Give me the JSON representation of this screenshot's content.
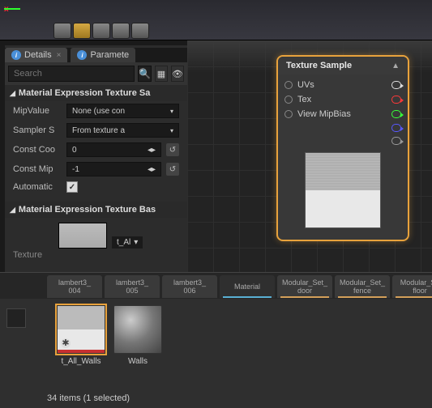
{
  "axis": {
    "x_label": "x"
  },
  "tabs": {
    "details": "Details",
    "parameters": "Paramete"
  },
  "search": {
    "placeholder": "Search"
  },
  "section1": {
    "title": "Material Expression Texture Sa"
  },
  "props": {
    "mipValue": {
      "label": "MipValue",
      "value": "None (use con"
    },
    "sampler": {
      "label": "Sampler S",
      "value": "From texture a"
    },
    "constCoord": {
      "label": "Const Coo",
      "value": "0"
    },
    "constMip": {
      "label": "Const Mip",
      "value": "-1"
    },
    "automatic": {
      "label": "Automatic",
      "checked": "✓"
    }
  },
  "section2": {
    "title": "Material Expression Texture Bas"
  },
  "texRow": {
    "label": "Texture",
    "dropdown": "t_Al"
  },
  "node": {
    "title": "Texture Sample",
    "pins": {
      "uvs": "UVs",
      "tex": "Tex",
      "mip": "View MipBias"
    }
  },
  "browserTabs": [
    {
      "line1": "lambert3_",
      "line2": "004"
    },
    {
      "line1": "lambert3_",
      "line2": "005"
    },
    {
      "line1": "lambert3_",
      "line2": "006"
    },
    {
      "line1": "Material",
      "line2": ""
    },
    {
      "line1": "Modular_Set_",
      "line2": "door"
    },
    {
      "line1": "Modular_Set_",
      "line2": "fence"
    },
    {
      "line1": "Modular_Se",
      "line2": "floor"
    }
  ],
  "assets": [
    {
      "name": "t_All_Walls"
    },
    {
      "name": "Walls"
    }
  ],
  "status": "34 items (1 selected)"
}
